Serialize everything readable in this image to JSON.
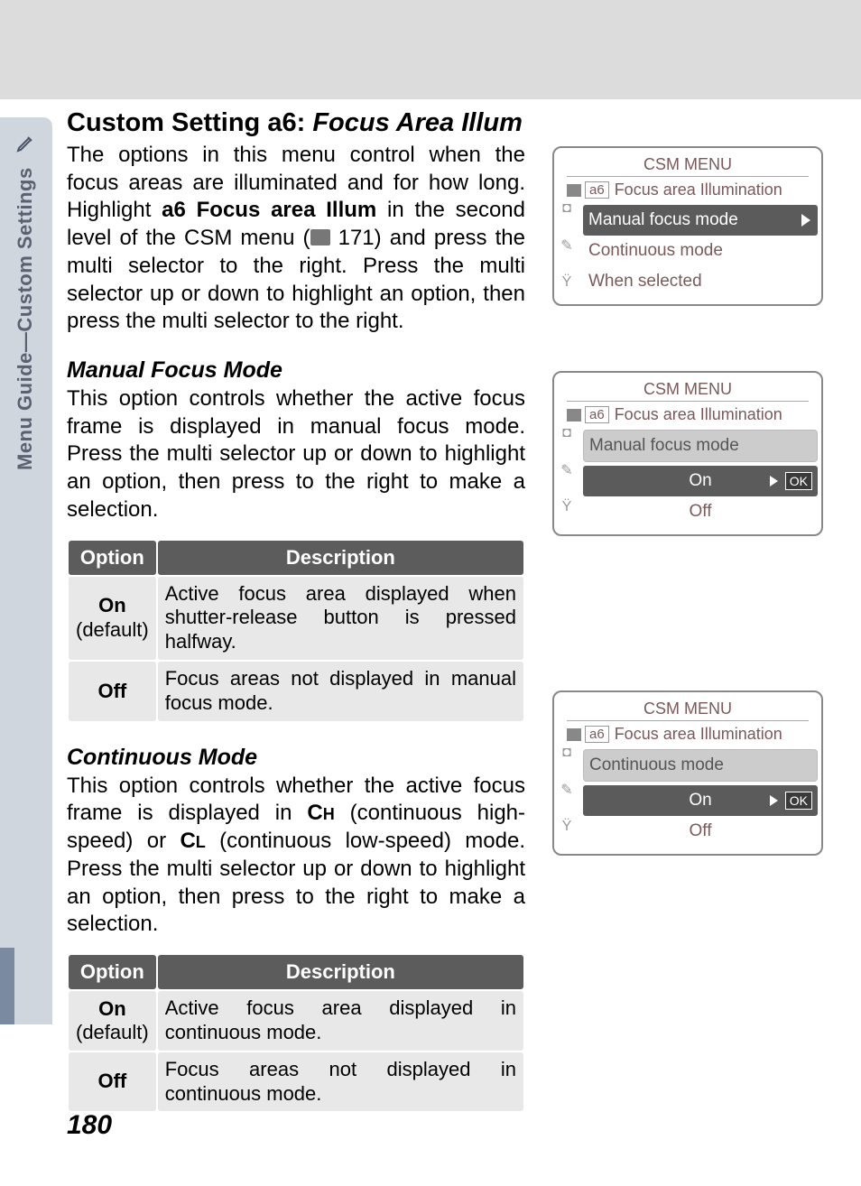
{
  "sidebar": {
    "label": "Menu Guide—Custom Settings"
  },
  "title": {
    "prefix": "Custom Setting a6: ",
    "italic": "Focus Area Illum"
  },
  "intro": {
    "part1": "The options in this menu control when the focus areas are illuminated and for how long.  Highlight ",
    "bold": "a6 Focus area Illum",
    "part2": " in the second level of the CSM menu (",
    "ref": " 171) and press the multi selector to the right.  Press the multi selector up or down to highlight an option, then press the multi selector to the right."
  },
  "manual": {
    "heading": "Manual Focus Mode",
    "body": "This option controls whether the active focus frame is displayed in manual focus mode.  Press the multi selector up or down to highlight an option, then press to the right to make a selection.",
    "table": {
      "h1": "Option",
      "h2": "Description",
      "r1o_main": "On",
      "r1o_def": "(default)",
      "r1d": "Active focus area displayed when shutter-release button is pressed halfway.",
      "r2o": "Off",
      "r2d": "Focus areas not displayed in manual focus mode."
    }
  },
  "cont": {
    "heading": "Continuous Mode",
    "body_a": "This option controls whether the active focus frame is displayed in ",
    "ch": "C",
    "ch_sub": "H",
    "body_b": " (continuous high-speed) or ",
    "cl": "C",
    "cl_sub": "L",
    "body_c": " (continuous low-speed) mode.  Press the multi selector up or down to highlight an option, then press to the right to make a selection.",
    "table": {
      "h1": "Option",
      "h2": "Description",
      "r1o_main": "On",
      "r1o_def": "(default)",
      "r1d": "Active focus area displayed in continuous mode.",
      "r2o": "Off",
      "r2d": "Focus areas not displayed in continuous mode."
    }
  },
  "screens": {
    "title": "CSM MENU",
    "sub_idx": "a6",
    "sub": "Focus area Illumination",
    "s1": {
      "i1": "Manual focus mode",
      "i2": "Continuous mode",
      "i3": "When selected"
    },
    "s2": {
      "head": "Manual focus mode",
      "on": "On",
      "off": "Off",
      "ok": "OK"
    },
    "s3": {
      "head": "Continuous mode",
      "on": "On",
      "off": "Off",
      "ok": "OK"
    }
  },
  "page": "180"
}
